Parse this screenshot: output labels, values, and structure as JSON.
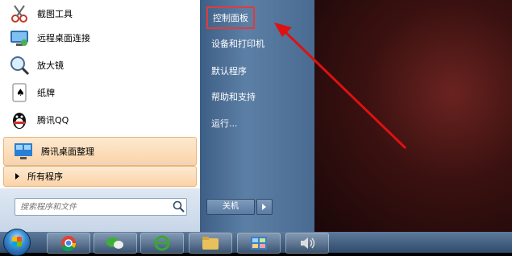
{
  "left_menu": {
    "items": [
      {
        "label": "截图工具",
        "icon": "scissors-icon"
      },
      {
        "label": "远程桌面连接",
        "icon": "remote-desktop-icon"
      },
      {
        "label": "放大镜",
        "icon": "magnifier-icon"
      },
      {
        "label": "纸牌",
        "icon": "cards-icon"
      },
      {
        "label": "腾讯QQ",
        "icon": "qq-penguin-icon"
      },
      {
        "label": "腾讯桌面整理",
        "icon": "desktop-organizer-icon"
      }
    ],
    "all_programs": "所有程序",
    "search_placeholder": "搜索程序和文件"
  },
  "right_menu": {
    "items": [
      "控制面板",
      "设备和打印机",
      "默认程序",
      "帮助和支持",
      "运行..."
    ],
    "shutdown_label": "关机"
  },
  "taskbar": {
    "buttons": [
      "start-orb-icon",
      "chrome-icon",
      "wechat-icon",
      "ie-icon",
      "explorer-folder-icon",
      "control-panel-icon",
      "volume-icon"
    ]
  },
  "colors": {
    "highlight_box": "#e23b3b",
    "right_pane": "#5c7fa6"
  }
}
